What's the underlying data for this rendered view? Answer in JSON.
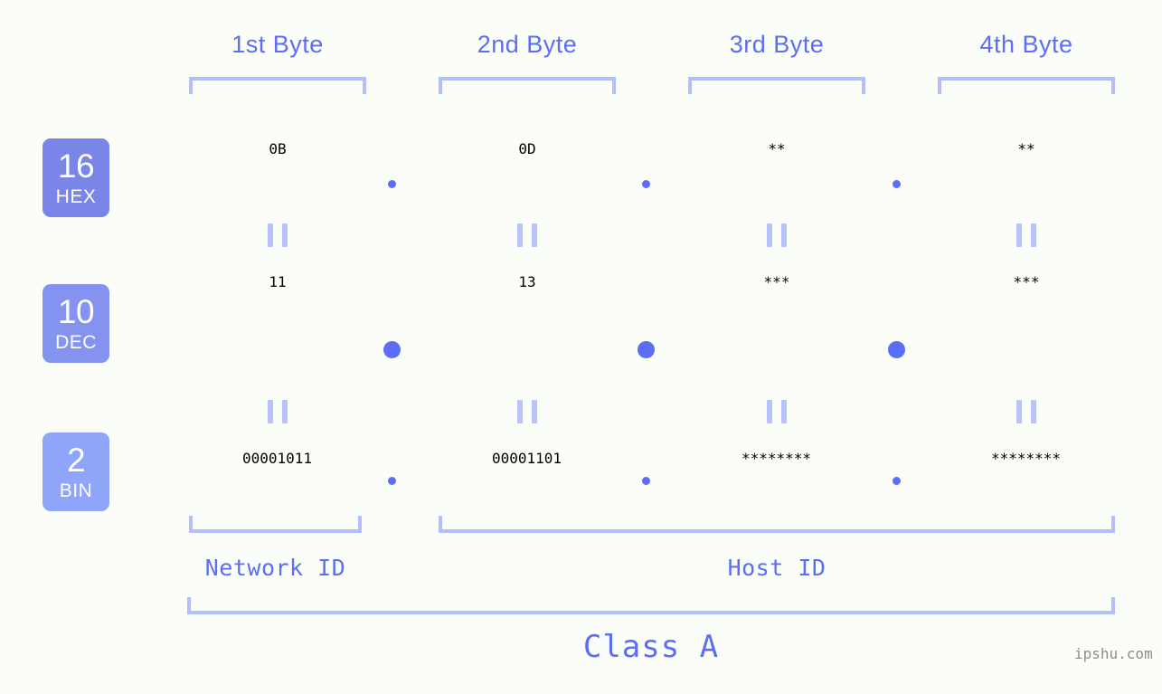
{
  "byte_headers": [
    {
      "label": "1st Byte"
    },
    {
      "label": "2nd Byte"
    },
    {
      "label": "3rd Byte"
    },
    {
      "label": "4th Byte"
    }
  ],
  "rows": [
    {
      "base_number": "16",
      "base_unit": "HEX",
      "badge_color": "#7986e8",
      "values": [
        "0B",
        "0D",
        "**",
        "**"
      ],
      "separator": "."
    },
    {
      "base_number": "10",
      "base_unit": "DEC",
      "badge_color": "#8493f0",
      "values": [
        "11",
        "13",
        "***",
        "***"
      ],
      "separator": "."
    },
    {
      "base_number": "2",
      "base_unit": "BIN",
      "badge_color": "#8fa5fa",
      "values": [
        "00001011",
        "00001101",
        "********",
        "********"
      ],
      "separator": "."
    }
  ],
  "equals_mark": "=",
  "segments": [
    {
      "label": "Network ID"
    },
    {
      "label": "Host ID"
    }
  ],
  "class_label": "Class A",
  "watermark": "ipshu.com",
  "colors": {
    "background": "#fbfdf8",
    "accent": "#5b6ef5",
    "accent_light": "#8b9af7",
    "bracket": "#b3bffa",
    "watermark": "#8d8d8d"
  }
}
